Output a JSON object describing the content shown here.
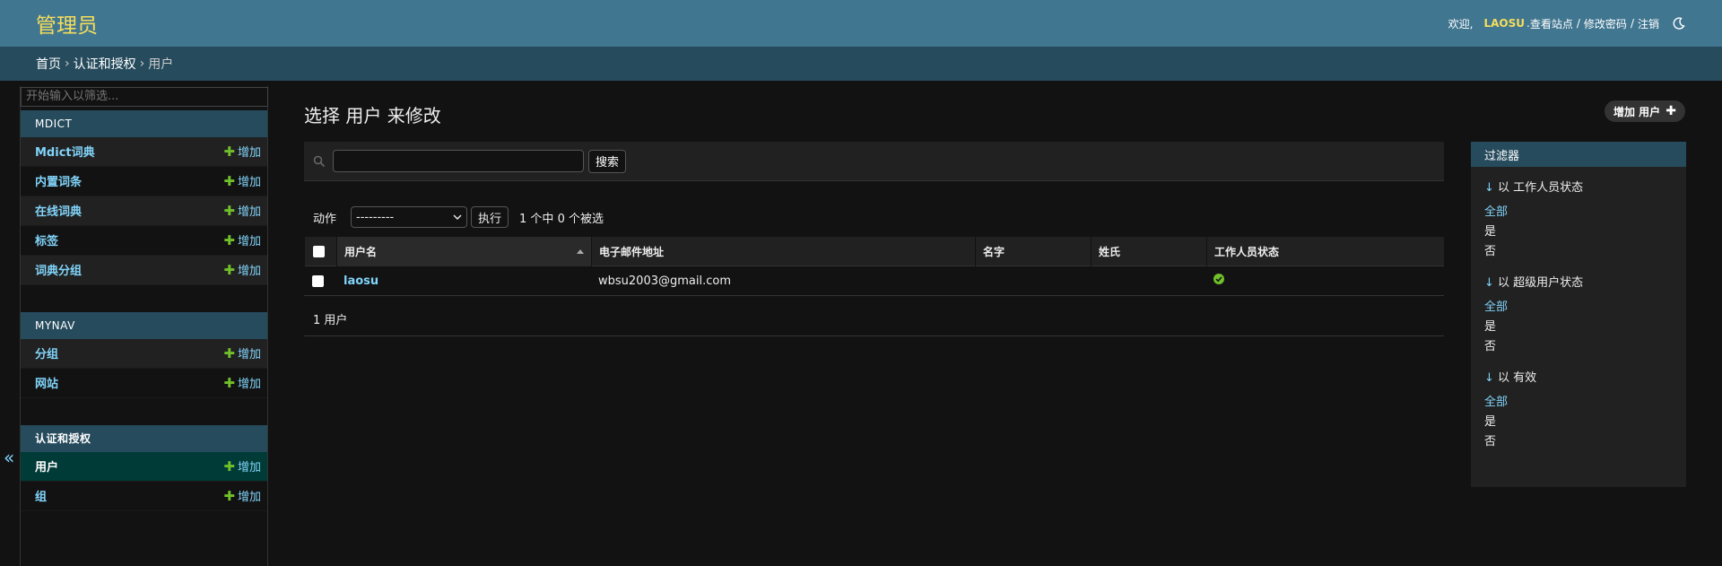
{
  "header": {
    "brand": "管理员",
    "welcome": "欢迎,",
    "username": "LAOSU",
    "view_site": "查看站点",
    "change_password": "修改密码",
    "logout": "注销",
    "sep": "/",
    "theme_icon": "moon-icon"
  },
  "breadcrumb": {
    "home": "首页",
    "app": "认证和授权",
    "current": "用户",
    "arrow": "›"
  },
  "sidebar": {
    "filter_placeholder": "开始输入以筛选...",
    "add_label": "增加",
    "plus": "✚",
    "collapse": "«",
    "modules": [
      {
        "name": "MDICT",
        "items": [
          "Mdict词典",
          "内置词条",
          "在线词典",
          "标签",
          "词典分组"
        ]
      },
      {
        "name": "MYNAV",
        "items": [
          "分组",
          "网站"
        ]
      },
      {
        "name": "认证和授权",
        "items": [
          "用户",
          "组"
        ]
      }
    ]
  },
  "main": {
    "title": "选择 用户 来修改",
    "add_button": "增加 用户",
    "add_icon": "✚",
    "search_button": "搜索",
    "action_label": "动作",
    "action_select": "---------",
    "go_button": "执行",
    "selection_counter": "1 个中 0 个被选",
    "columns": [
      "用户名",
      "电子邮件地址",
      "名字",
      "姓氏",
      "工作人员状态"
    ],
    "rows": [
      {
        "username": "laosu",
        "email": "wbsu2003@gmail.com",
        "first_name": "",
        "last_name": "",
        "is_staff": true
      }
    ],
    "paginator": "1 用户"
  },
  "filter": {
    "title": "过滤器",
    "arrow": "↓",
    "groups": [
      {
        "title": "以 工作人员状态",
        "options": [
          "全部",
          "是",
          "否"
        ]
      },
      {
        "title": "以 超级用户状态",
        "options": [
          "全部",
          "是",
          "否"
        ]
      },
      {
        "title": "以 有效",
        "options": [
          "全部",
          "是",
          "否"
        ]
      }
    ]
  },
  "colors": {
    "header": "#417690",
    "breadcrumb": "#264b5d",
    "brand": "#f5dd5d",
    "link": "#81d4fa",
    "add_green": "#70bf2b"
  }
}
